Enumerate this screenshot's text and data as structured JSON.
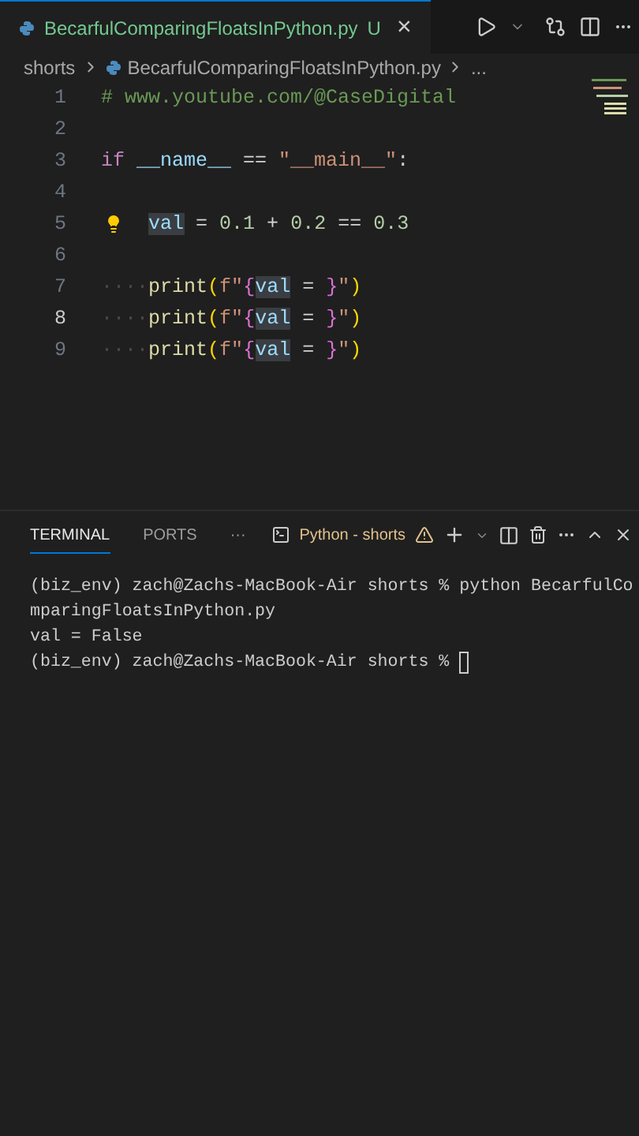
{
  "editor_tab": {
    "filename": "BecarfulComparingFloatsInPython.py",
    "status": "U",
    "close": "×",
    "selected": true
  },
  "breadcrumb": [
    "shorts",
    "BecarfulComparingFloatsInPython.py",
    "..."
  ],
  "code": [
    {
      "number": "1",
      "current": false,
      "lightbulb": false,
      "tokens": [
        {
          "text": "# www.youtube.com/@CaseDigital",
          "kind": "comment"
        }
      ]
    },
    {
      "number": "2",
      "current": false,
      "lightbulb": false
    },
    {
      "number": "3",
      "current": false,
      "lightbulb": false,
      "tokens": [
        {
          "text": "if",
          "kind": "keyword"
        },
        {
          "text": " __name__",
          "kind": "variable"
        },
        {
          "text": " == ",
          "kind": "plain"
        },
        {
          "text": "\"__main__\"",
          "kind": "string"
        },
        {
          "text": ":",
          "kind": "plain"
        }
      ]
    },
    {
      "number": "4",
      "current": false,
      "lightbulb": false
    },
    {
      "number": "5",
      "current": false,
      "lightbulb": true,
      "tokens": [
        {
          "text": "val",
          "kind": "highlight"
        },
        {
          "text": " = ",
          "kind": "plain"
        },
        {
          "text": "0.1",
          "kind": "number"
        },
        {
          "text": " + ",
          "kind": "plain"
        },
        {
          "text": "0.2",
          "kind": "number"
        },
        {
          "text": " == ",
          "kind": "plain"
        },
        {
          "text": "0.3",
          "kind": "number"
        }
      ]
    },
    {
      "number": "6",
      "current": false,
      "lightbulb": false
    },
    {
      "number": "7",
      "current": false,
      "lightbulb": false,
      "tokens": [
        {
          "text": "····",
          "kind": "whitespace"
        },
        {
          "text": "print",
          "kind": "function"
        },
        {
          "text": "(",
          "kind": "paren"
        },
        {
          "text": "f\"",
          "kind": "string"
        },
        {
          "text": "{",
          "kind": "brace"
        },
        {
          "text": "val",
          "kind": "highlight"
        },
        {
          "text": " = ",
          "kind": "plain"
        },
        {
          "text": "}",
          "kind": "brace"
        },
        {
          "text": "\"",
          "kind": "string"
        },
        {
          "text": ")",
          "kind": "paren"
        }
      ]
    },
    {
      "number": "8",
      "current": true,
      "lightbulb": false,
      "tokens": [
        {
          "text": "····",
          "kind": "whitespace"
        },
        {
          "text": "print",
          "kind": "function"
        },
        {
          "text": "(",
          "kind": "paren"
        },
        {
          "text": "f\"",
          "kind": "string"
        },
        {
          "text": "{",
          "kind": "brace"
        },
        {
          "text": "val",
          "kind": "highlight"
        },
        {
          "text": " = ",
          "kind": "plain"
        },
        {
          "text": "}",
          "kind": "brace"
        },
        {
          "text": "\"",
          "kind": "string"
        },
        {
          "text": ")",
          "kind": "paren"
        }
      ]
    },
    {
      "number": "9",
      "current": false,
      "lightbulb": false,
      "tokens": [
        {
          "text": "····",
          "kind": "whitespace"
        },
        {
          "text": "print",
          "kind": "function"
        },
        {
          "text": "(",
          "kind": "paren"
        },
        {
          "text": "f\"",
          "kind": "string"
        },
        {
          "text": "{",
          "kind": "brace"
        },
        {
          "text": "val",
          "kind": "highlight"
        },
        {
          "text": " = ",
          "kind": "plain"
        },
        {
          "text": "}",
          "kind": "brace"
        },
        {
          "text": "\"",
          "kind": "string"
        },
        {
          "text": ")",
          "kind": "paren"
        }
      ]
    }
  ],
  "panel_tabs": [
    {
      "label": "TERMINAL",
      "selected": true
    },
    {
      "label": "PORTS",
      "selected": false
    },
    {
      "label": "···",
      "selected": false
    }
  ],
  "terminal_name": "Python - shorts",
  "terminal_lines": [
    {
      "text": "(biz_env) zach@Zachs-MacBook-Air shorts % python BecarfulCo",
      "cursor": false
    },
    {
      "text": "mparingFloatsInPython.py",
      "cursor": false
    },
    {
      "text": "val = False",
      "cursor": false
    },
    {
      "text": "(biz_env) zach@Zachs-MacBook-Air shorts % ",
      "cursor": true
    }
  ]
}
